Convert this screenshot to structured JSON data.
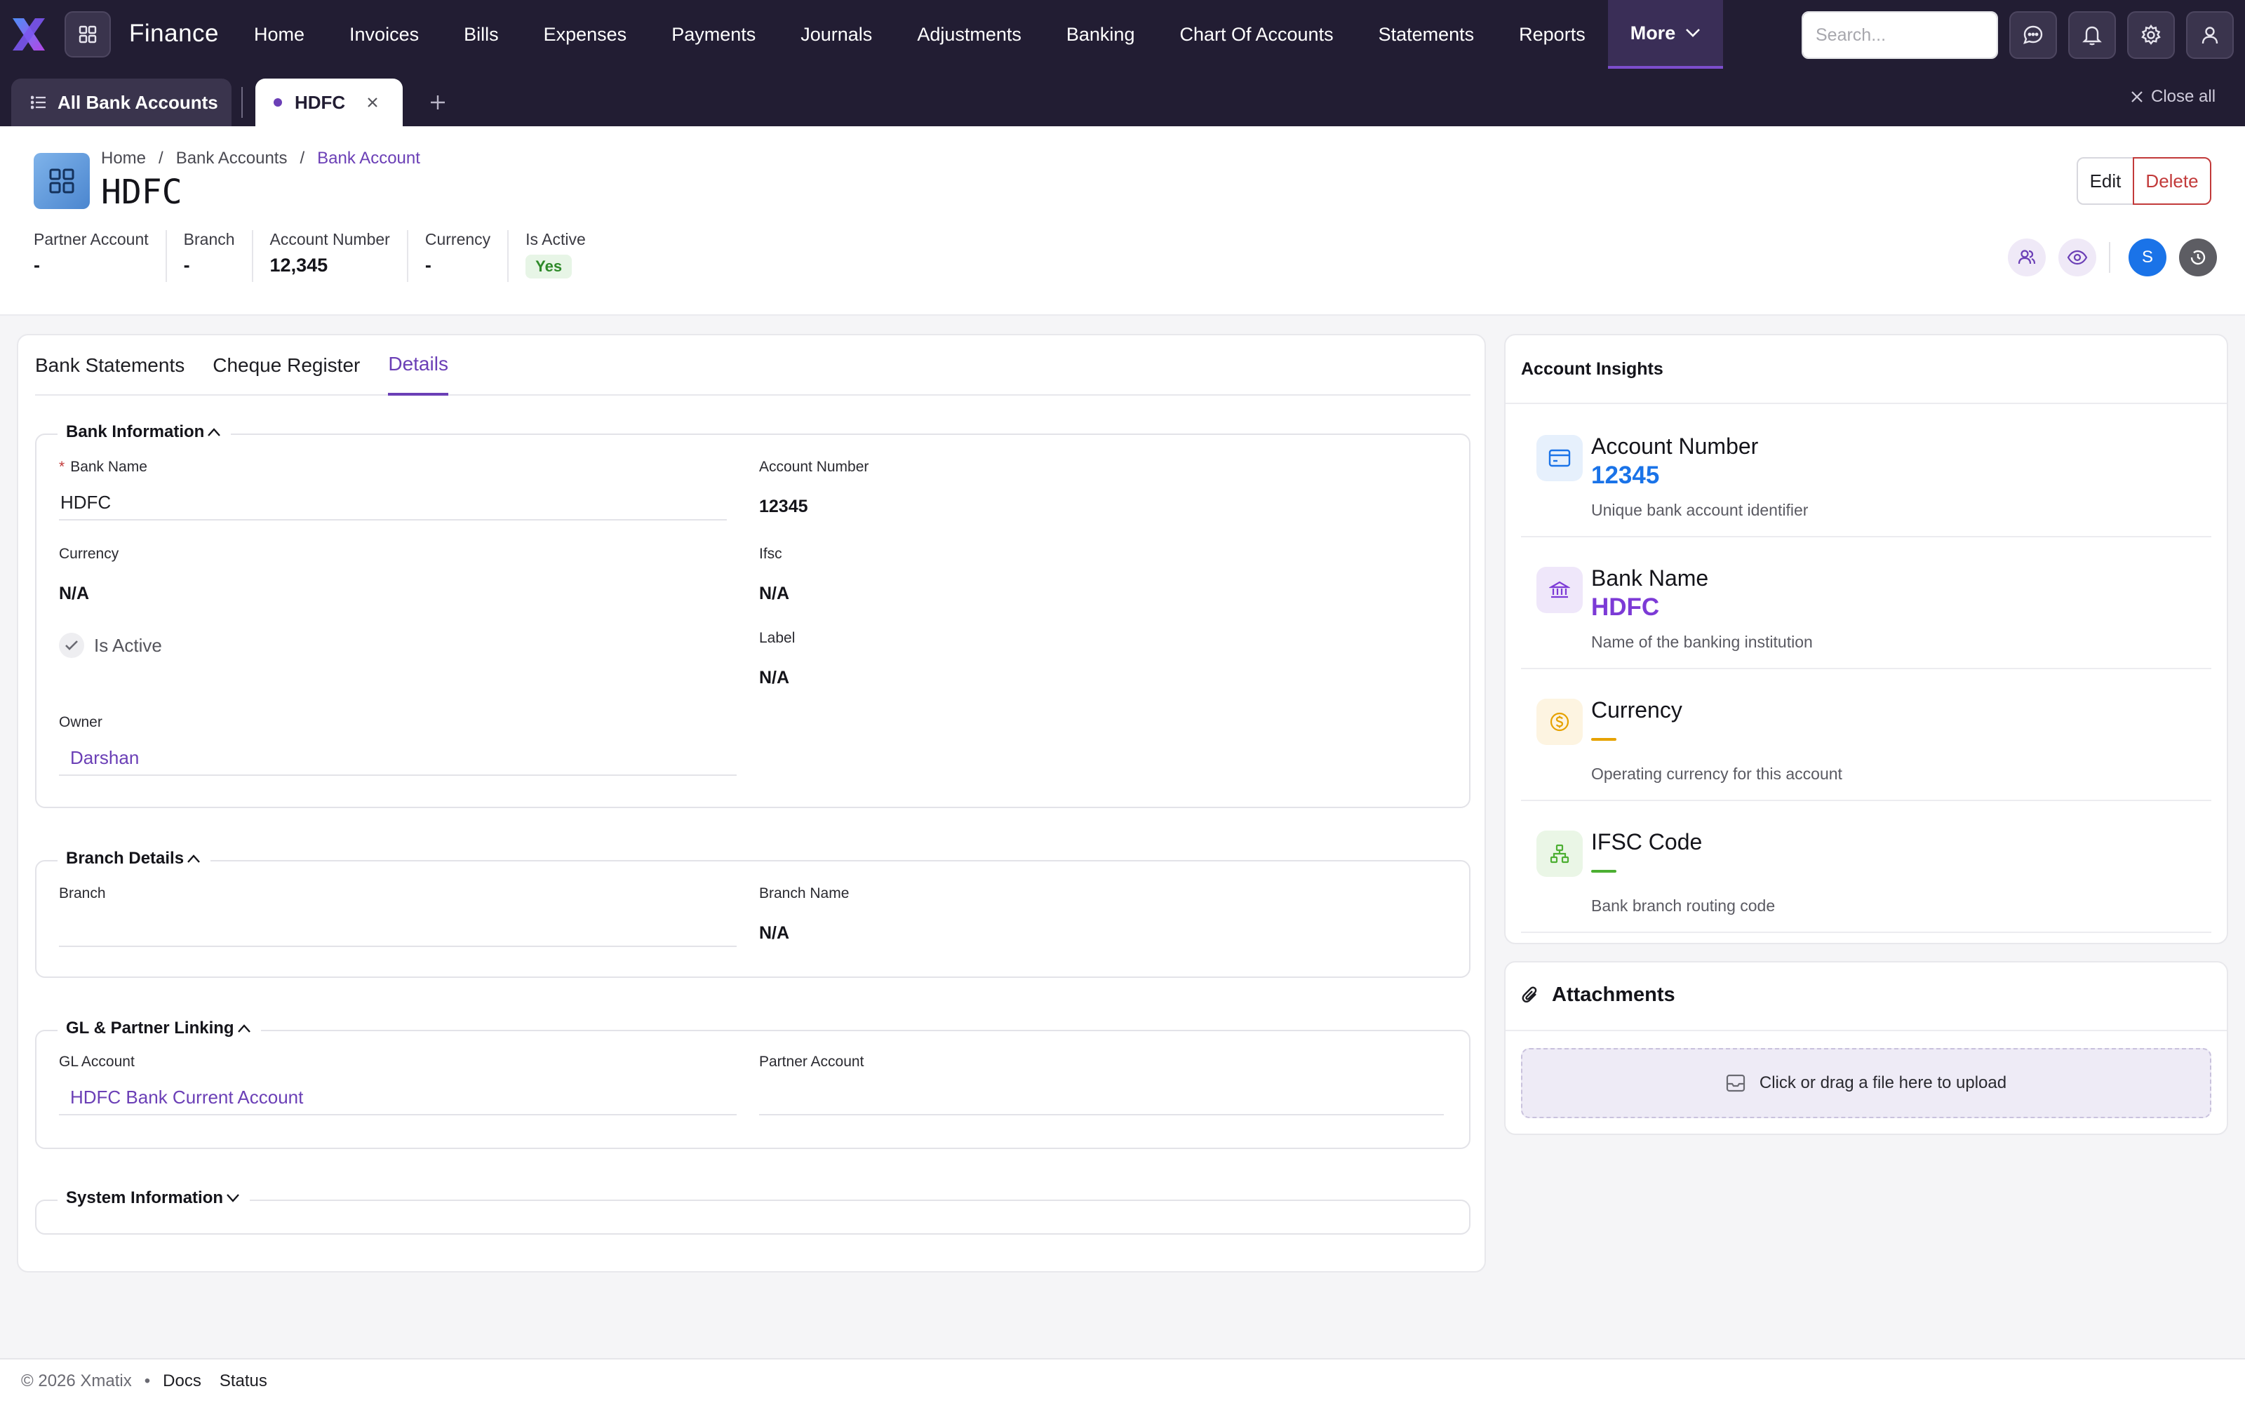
{
  "app": {
    "name": "Finance",
    "nav": [
      "Home",
      "Invoices",
      "Bills",
      "Expenses",
      "Payments",
      "Journals",
      "Adjustments",
      "Banking",
      "Chart Of Accounts",
      "Statements",
      "Reports"
    ],
    "more_label": "More",
    "search_placeholder": "Search...",
    "accent": "#6b3fb6"
  },
  "tabs_bar": {
    "all_label": "All Bank Accounts",
    "open_tab": "HDFC",
    "close_all": "Close all"
  },
  "header": {
    "breadcrumb": [
      "Home",
      "Bank Accounts",
      "Bank Account"
    ],
    "title": "HDFC",
    "edit_label": "Edit",
    "delete_label": "Delete",
    "meta": [
      {
        "label": "Partner Account",
        "value": "-"
      },
      {
        "label": "Branch",
        "value": "-"
      },
      {
        "label": "Account Number",
        "value": "12,345"
      },
      {
        "label": "Currency",
        "value": "-"
      },
      {
        "label": "Is Active",
        "value": "Yes"
      }
    ],
    "avatar_letter": "S"
  },
  "detail_tabs": [
    "Bank Statements",
    "Cheque Register",
    "Details"
  ],
  "active_tab": "Details",
  "sections": {
    "bank_info": {
      "title": "Bank Information",
      "bank_name_label": "Bank Name",
      "bank_name_value": "HDFC",
      "account_number_label": "Account Number",
      "account_number_value": "12345",
      "currency_label": "Currency",
      "currency_value": "N/A",
      "ifsc_label": "Ifsc",
      "ifsc_value": "N/A",
      "is_active_label": "Is Active",
      "label_label": "Label",
      "label_value": "N/A",
      "owner_label": "Owner",
      "owner_value": "Darshan"
    },
    "branch": {
      "title": "Branch Details",
      "branch_label": "Branch",
      "branch_name_label": "Branch Name",
      "branch_name_value": "N/A"
    },
    "gl": {
      "title": "GL & Partner Linking",
      "gl_label": "GL Account",
      "gl_value": "HDFC Bank Current Account",
      "partner_label": "Partner Account"
    },
    "system": {
      "title": "System Information"
    }
  },
  "insights": {
    "title": "Account Insights",
    "items": [
      {
        "name": "Account Number",
        "value": "12345",
        "desc": "Unique bank account identifier",
        "color": "#1a73e8",
        "bg": "#e6f0fc",
        "icon": "credit-card-icon"
      },
      {
        "name": "Bank Name",
        "value": "HDFC",
        "desc": "Name of the banking institution",
        "color": "#7c3ad6",
        "bg": "#efe7fa",
        "icon": "bank-icon"
      },
      {
        "name": "Currency",
        "value": "",
        "desc": "Operating currency for this account",
        "color": "#e6a200",
        "bg": "#fdf4e1",
        "icon": "dollar-coin-icon"
      },
      {
        "name": "IFSC Code",
        "value": "",
        "desc": "Bank branch routing code",
        "color": "#4caf32",
        "bg": "#eaf6e6",
        "icon": "network-icon"
      }
    ]
  },
  "attachments": {
    "title": "Attachments",
    "dropzone": "Click or drag a file here to upload"
  },
  "footer": {
    "copyright": "© 2026 Xmatix",
    "links": [
      "Docs",
      "Status"
    ]
  }
}
